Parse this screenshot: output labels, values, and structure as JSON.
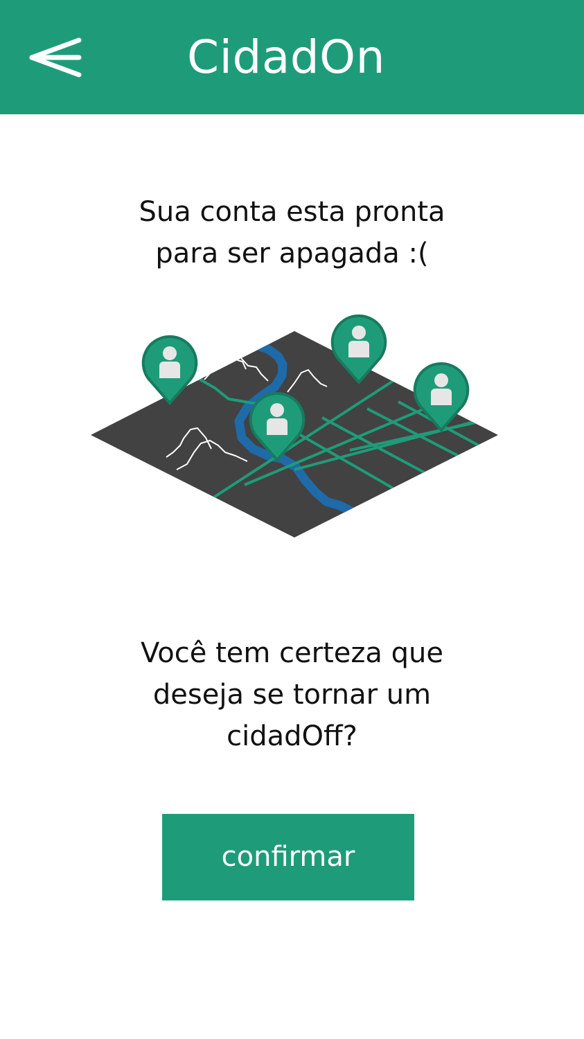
{
  "header": {
    "title": "CidadOn",
    "back_icon": "back-arrow-icon",
    "color": "#1e9c79"
  },
  "message_top": {
    "line1": "Sua conta esta pronta",
    "line2": "para ser apagada :("
  },
  "illustration": {
    "icon": "city-map-pins-icon",
    "map_color": "#424242",
    "road_color": "#1e9c79",
    "river_color": "#1f6aa8",
    "pin_color": "#1e9c79",
    "pin_count": 4
  },
  "message_bottom": {
    "line1": "Você tem certeza que",
    "line2": "deseja se tornar um",
    "line3": "cidadOff?"
  },
  "confirm_button": {
    "label": "confirmar",
    "color": "#1e9c79"
  }
}
